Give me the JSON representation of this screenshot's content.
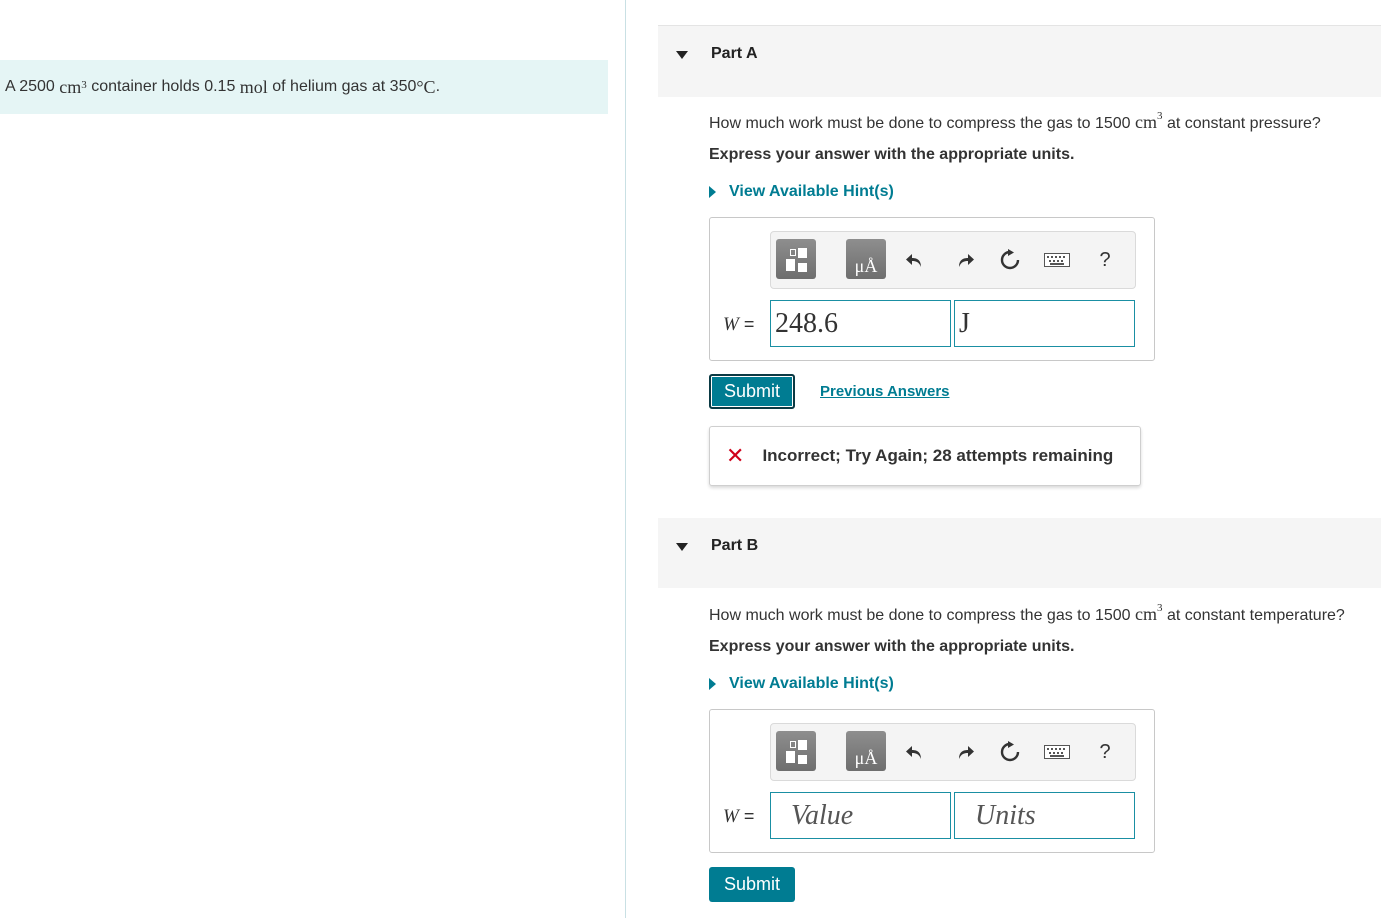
{
  "problem": {
    "prefix": "A 2500 ",
    "volume_unit": "cm",
    "volume_exp": "3",
    "mid": " container holds 0.15 ",
    "mol_unit": "mol",
    "suffix": " of helium gas at 350",
    "temp_unit": "°C",
    "period": "."
  },
  "partA": {
    "title": "Part A",
    "question_prefix": "How much work must be done to compress the gas to 1500 ",
    "question_unit": "cm",
    "question_exp": "3",
    "question_suffix": " at constant pressure?",
    "instruction": "Express your answer with the appropriate units.",
    "hint_label": "View Available Hint(s)",
    "variable": "W",
    "equals": " =",
    "value": "248.6",
    "unit": "J",
    "submit_label": "Submit",
    "previous_answers_label": "Previous Answers",
    "feedback_icon": "✕",
    "feedback_message": "Incorrect; Try Again; 28 attempts remaining"
  },
  "partB": {
    "title": "Part B",
    "question_prefix": "How much work must be done to compress the gas to 1500 ",
    "question_unit": "cm",
    "question_exp": "3",
    "question_suffix": " at constant temperature?",
    "instruction": "Express your answer with the appropriate units.",
    "hint_label": "View Available Hint(s)",
    "variable": "W",
    "equals": " =",
    "value_placeholder": "Value",
    "unit_placeholder": "Units",
    "submit_label": "Submit"
  },
  "toolbar": {
    "units_glyph": "μÅ",
    "help_glyph": "?",
    "icons": [
      "templates-icon",
      "units-icon",
      "undo-icon",
      "redo-icon",
      "reset-icon",
      "keyboard-icon",
      "help-icon"
    ]
  },
  "colors": {
    "accent": "#007c92",
    "problem_bg": "#e5f5f5",
    "header_bg": "#f5f5f5",
    "error": "#d0021b"
  }
}
